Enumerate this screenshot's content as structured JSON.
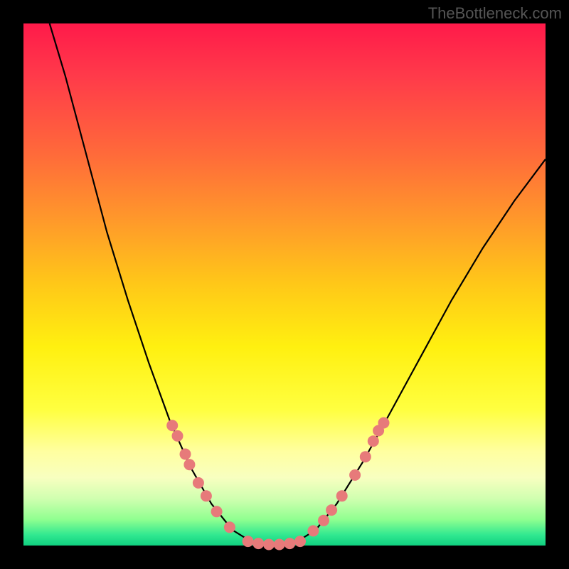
{
  "watermark": "TheBottleneck.com",
  "colors": {
    "background": "#000000",
    "curve_stroke": "#000000",
    "dot_fill": "#e77a7a",
    "dot_stroke": "#c85a5a"
  },
  "chart_data": {
    "type": "line",
    "title": "",
    "xlabel": "",
    "ylabel": "",
    "xlim": [
      0,
      100
    ],
    "ylim": [
      0,
      100
    ],
    "curve": {
      "description": "V-shaped bottleneck curve; y represents bottleneck percentage (0 = no bottleneck at bottom, 100 = max at top)",
      "points": [
        {
          "x": 5,
          "y": 100
        },
        {
          "x": 8,
          "y": 90
        },
        {
          "x": 12,
          "y": 75
        },
        {
          "x": 16,
          "y": 60
        },
        {
          "x": 20,
          "y": 47
        },
        {
          "x": 24,
          "y": 35
        },
        {
          "x": 28,
          "y": 24
        },
        {
          "x": 32,
          "y": 15
        },
        {
          "x": 36,
          "y": 8
        },
        {
          "x": 40,
          "y": 3
        },
        {
          "x": 44,
          "y": 0.5
        },
        {
          "x": 48,
          "y": 0
        },
        {
          "x": 52,
          "y": 0.5
        },
        {
          "x": 56,
          "y": 3
        },
        {
          "x": 60,
          "y": 8
        },
        {
          "x": 65,
          "y": 16
        },
        {
          "x": 70,
          "y": 25
        },
        {
          "x": 76,
          "y": 36
        },
        {
          "x": 82,
          "y": 47
        },
        {
          "x": 88,
          "y": 57
        },
        {
          "x": 94,
          "y": 66
        },
        {
          "x": 100,
          "y": 74
        }
      ]
    },
    "series": [
      {
        "name": "left-branch-dots",
        "points": [
          {
            "x": 28.5,
            "y": 23
          },
          {
            "x": 29.5,
            "y": 21
          },
          {
            "x": 31,
            "y": 17.5
          },
          {
            "x": 31.8,
            "y": 15.5
          },
          {
            "x": 33.5,
            "y": 12
          },
          {
            "x": 35,
            "y": 9.5
          },
          {
            "x": 37,
            "y": 6.5
          },
          {
            "x": 39.5,
            "y": 3.5
          }
        ]
      },
      {
        "name": "bottom-dots",
        "points": [
          {
            "x": 43,
            "y": 0.8
          },
          {
            "x": 45,
            "y": 0.4
          },
          {
            "x": 47,
            "y": 0.2
          },
          {
            "x": 49,
            "y": 0.2
          },
          {
            "x": 51,
            "y": 0.4
          },
          {
            "x": 53,
            "y": 0.8
          }
        ]
      },
      {
        "name": "right-branch-dots",
        "points": [
          {
            "x": 55.5,
            "y": 2.8
          },
          {
            "x": 57.5,
            "y": 4.8
          },
          {
            "x": 59,
            "y": 6.8
          },
          {
            "x": 61,
            "y": 9.5
          },
          {
            "x": 63.5,
            "y": 13.5
          },
          {
            "x": 65.5,
            "y": 17
          },
          {
            "x": 67,
            "y": 20
          },
          {
            "x": 68,
            "y": 22
          },
          {
            "x": 69,
            "y": 23.5
          }
        ]
      }
    ]
  }
}
